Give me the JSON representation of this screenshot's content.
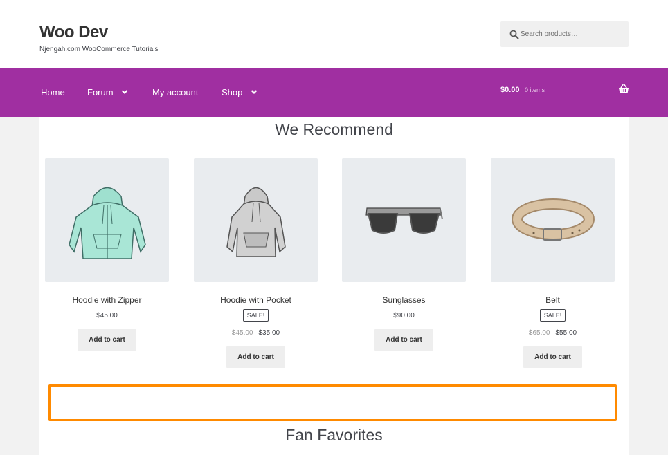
{
  "site": {
    "title": "Woo Dev",
    "tagline": "Njengah.com WooCommerce Tutorials"
  },
  "search": {
    "placeholder": "Search products…",
    "icon": "search-icon"
  },
  "nav": {
    "items": [
      {
        "label": "Home",
        "has_dropdown": false
      },
      {
        "label": "Forum",
        "has_dropdown": true
      },
      {
        "label": "My account",
        "has_dropdown": false
      },
      {
        "label": "Shop",
        "has_dropdown": true
      }
    ],
    "cart_amount": "$0.00",
    "cart_items": "0 items",
    "cart_icon": "basket-icon"
  },
  "colors": {
    "nav_bg": "#a02fa1",
    "highlight": "#ff8a00",
    "product_bg": "#e9ecef",
    "button_bg": "#eeeeee"
  },
  "recommend": {
    "title": "We Recommend",
    "products": [
      {
        "name": "Hoodie with Zipper",
        "price": "$45.00",
        "on_sale": false,
        "button": "Add to cart",
        "image": "zip-hoodie-image"
      },
      {
        "name": "Hoodie with Pocket",
        "sale_badge": "SALE!",
        "old_price": "$45.00",
        "price": "$35.00",
        "on_sale": true,
        "button": "Add to cart",
        "image": "pocket-hoodie-image"
      },
      {
        "name": "Sunglasses",
        "price": "$90.00",
        "on_sale": false,
        "button": "Add to cart",
        "image": "sunglasses-image"
      },
      {
        "name": "Belt",
        "sale_badge": "SALE!",
        "old_price": "$65.00",
        "price": "$55.00",
        "on_sale": true,
        "button": "Add to cart",
        "image": "belt-image"
      }
    ]
  },
  "fan_favorites": {
    "title": "Fan Favorites"
  }
}
